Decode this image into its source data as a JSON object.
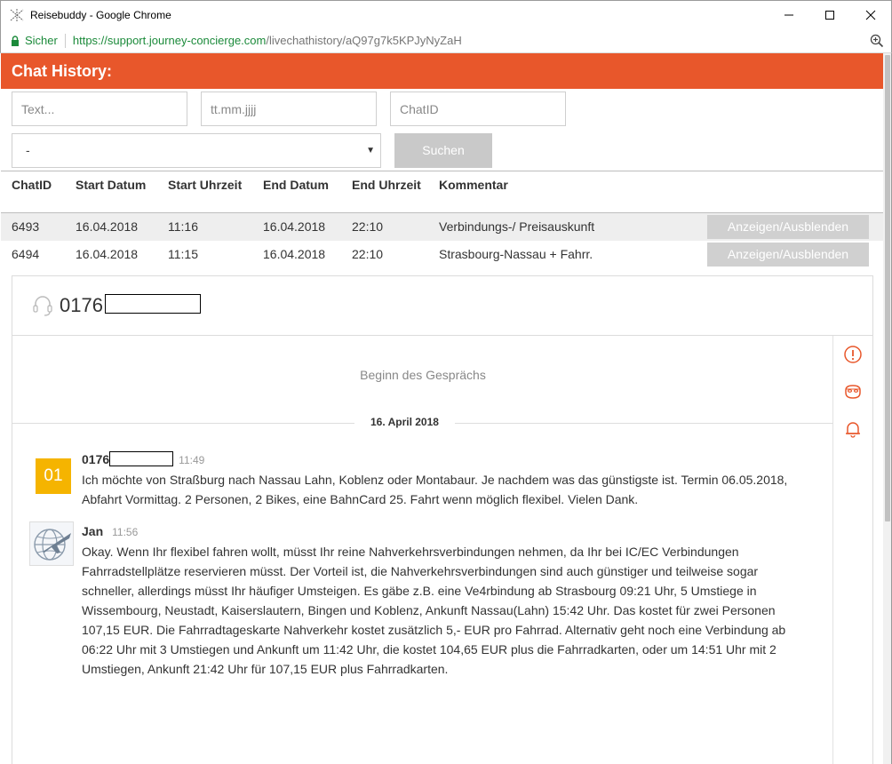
{
  "window": {
    "title": "Reisebuddy - Google Chrome"
  },
  "addressbar": {
    "secure_label": "Sicher",
    "url_host": "https://support.journey-concierge.com",
    "url_path": "/livechathistory/aQ97g7k5KPJyNyZaH"
  },
  "page": {
    "header_title": "Chat History:",
    "filters": {
      "text_placeholder": "Text...",
      "date_placeholder": "tt.mm.jjjj",
      "chatid_placeholder": "ChatID",
      "select_value": "-",
      "search_label": "Suchen"
    },
    "table": {
      "columns": [
        "ChatID",
        "Start Datum",
        "Start Uhrzeit",
        "End Datum",
        "End Uhrzeit",
        "Kommentar"
      ],
      "rows": [
        {
          "chat_id": "6493",
          "start_date": "16.04.2018",
          "start_time": "11:16",
          "end_date": "16.04.2018",
          "end_time": "22:10",
          "comment": "Verbindungs-/ Preisauskunft",
          "action": "Anzeigen/Ausblenden"
        },
        {
          "chat_id": "6494",
          "start_date": "16.04.2018",
          "start_time": "11:15",
          "end_date": "16.04.2018",
          "end_time": "22:10",
          "comment": "Strasbourg-Nassau + Fahrr.",
          "action": "Anzeigen/Ausblenden"
        }
      ]
    },
    "chat": {
      "caller": "0176",
      "begin_label": "Beginn des Gesprächs",
      "date_label": "16. April 2018",
      "messages": [
        {
          "avatar_text": "01",
          "sender": "0176",
          "time": "11:49",
          "text": "Ich möchte von Straßburg nach Nassau Lahn, Koblenz oder Montabaur. Je nachdem was das günstigste ist. Termin 06.05.2018, Abfahrt Vormittag. 2 Personen, 2 Bikes, eine BahnCard 25. Fahrt wenn möglich flexibel. Vielen Dank."
        },
        {
          "sender": "Jan",
          "time": "11:56",
          "text": "Okay. Wenn Ihr flexibel fahren wollt, müsst Ihr reine Nahverkehrsverbindungen nehmen, da Ihr bei IC/EC Verbindungen Fahrradstellplätze reservieren müsst. Der Vorteil ist, die Nahverkehrsverbindungen sind auch günstiger und teilweise sogar schneller, allerdings müsst Ihr häufiger Umsteigen. Es gäbe z.B. eine Ve4rbindung ab Strasbourg 09:21 Uhr, 5 Umstiege in Wissembourg, Neustadt, Kaiserslautern, Bingen und Koblenz, Ankunft Nassau(Lahn) 15:42 Uhr. Das kostet für zwei Personen 107,15 EUR. Die Fahrradtageskarte Nahverkehr kostet zusätzlich 5,- EUR pro Fahrrad. Alternativ geht noch eine Verbindung ab 06:22 Uhr mit 3 Umstiegen und Ankunft um 11:42 Uhr, die kostet 104,65 EUR plus die Fahrradkarten, oder um 14:51 Uhr mit 2 Umstiegen, Ankunft 21:42 Uhr für 107,15 EUR plus Fahrradkarten."
        }
      ]
    }
  },
  "colors": {
    "brand": "#e8572b",
    "avatar": "#f5b400",
    "secure": "#1b8a3a"
  }
}
